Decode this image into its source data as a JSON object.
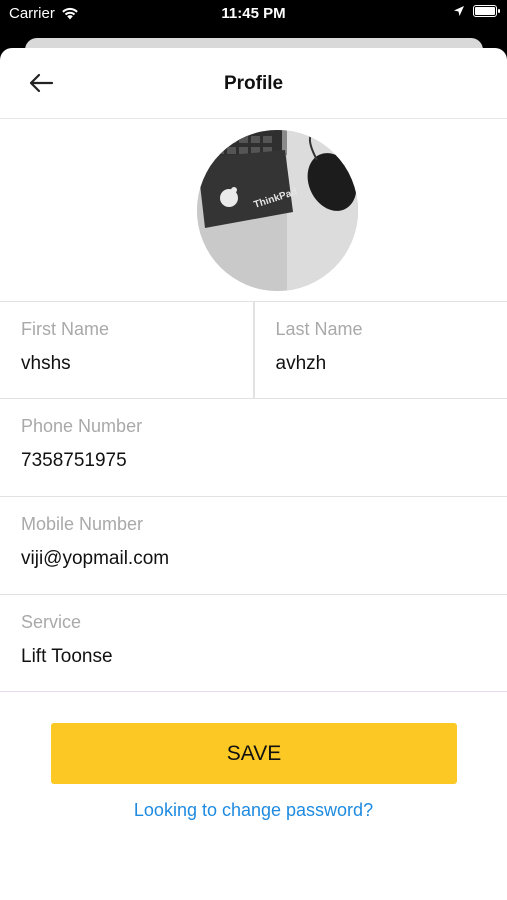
{
  "status_bar": {
    "carrier": "Carrier",
    "time": "11:45 PM"
  },
  "nav": {
    "title": "Profile"
  },
  "avatar": {
    "icon": "profile-photo"
  },
  "fields": {
    "first_name": {
      "label": "First Name",
      "value": "vhshs"
    },
    "last_name": {
      "label": "Last Name",
      "value": "avhzh"
    },
    "phone": {
      "label": "Phone Number",
      "value": "7358751975"
    },
    "mobile": {
      "label": "Mobile Number",
      "value": "viji@yopmail.com"
    },
    "service": {
      "label": "Service",
      "value": "Lift Toonse"
    }
  },
  "actions": {
    "save_label": "SAVE",
    "change_password_label": "Looking to change password?"
  },
  "colors": {
    "accent": "#fcc924",
    "link": "#1f8be0"
  }
}
